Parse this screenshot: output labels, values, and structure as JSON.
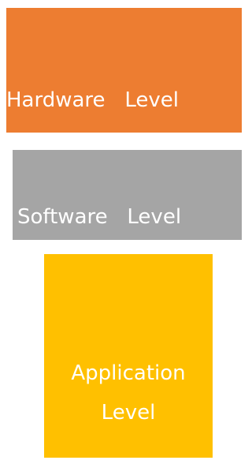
{
  "levels": [
    {
      "id": "hardware",
      "label": "Hardware   Level",
      "color": "#ED7D31"
    },
    {
      "id": "software",
      "label": "Software   Level",
      "color": "#A5A5A5"
    },
    {
      "id": "application",
      "label": "Application\nLevel",
      "color": "#FFC000"
    }
  ]
}
